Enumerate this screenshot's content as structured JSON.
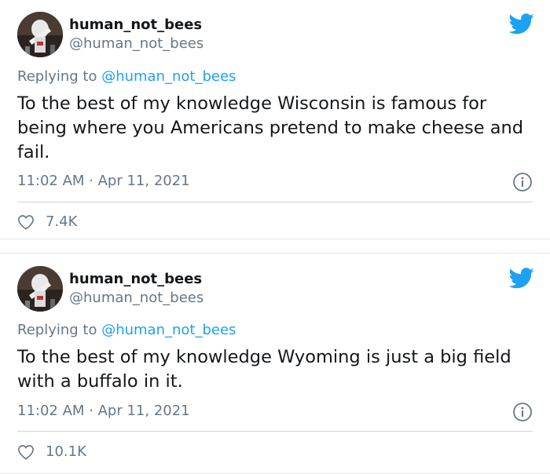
{
  "tweets": [
    {
      "display_name": "human_not_bees",
      "handle": "@human_not_bees",
      "replying_prefix": "Replying to ",
      "replying_to": "@human_not_bees",
      "text": "To the best of my knowledge Wisconsin is famous for being where you Americans pretend to make cheese and fail.",
      "timestamp": "11:02 AM · Apr 11, 2021",
      "likes": "7.4K"
    },
    {
      "display_name": "human_not_bees",
      "handle": "@human_not_bees",
      "replying_prefix": "Replying to ",
      "replying_to": "@human_not_bees",
      "text": "To the best of my knowledge Wyoming is just a big field with a buffalo in it.",
      "timestamp": "11:02 AM · Apr 11, 2021",
      "likes": "10.1K"
    }
  ],
  "icons": [
    "twitter-bird-icon",
    "info-icon",
    "heart-icon"
  ],
  "colors": {
    "accent": "#1da1f2",
    "muted": "#657786",
    "text": "#14171a"
  }
}
